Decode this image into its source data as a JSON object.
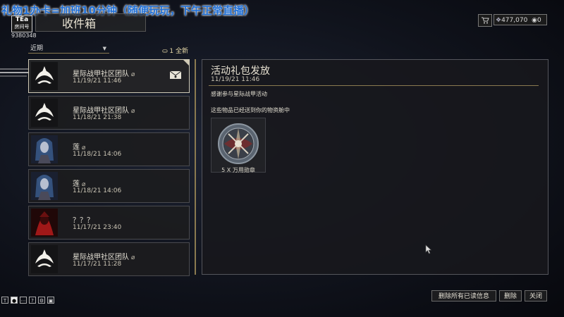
{
  "overlay": {
    "stream_title": "礼物1办卡=加班10分钟（随便玩玩，下午正常直播）",
    "room_badge_logo": "TEa",
    "room_badge_text": "房间号",
    "room_number": "9380348"
  },
  "header": {
    "title": "收件箱"
  },
  "currency": {
    "cart_icon": "cart-icon",
    "credits": "477,070",
    "platinum": "0"
  },
  "filter": {
    "selected": "近期",
    "new_count_label": "1 全新"
  },
  "messages": [
    {
      "sender": "星际战甲社区团队",
      "date": "11/19/21 11:46",
      "avatar": "lotus-logo",
      "attachment": true,
      "unread": true
    },
    {
      "sender": "星际战甲社区团队",
      "date": "11/18/21 21:38",
      "avatar": "lotus-logo",
      "attachment": true,
      "unread": false
    },
    {
      "sender": "莲",
      "date": "11/18/21 14:06",
      "avatar": "lotus-portrait",
      "attachment": true,
      "unread": false
    },
    {
      "sender": "莲",
      "date": "11/18/21 14:06",
      "avatar": "lotus-portrait",
      "attachment": true,
      "unread": false
    },
    {
      "sender": "？？？",
      "date": "11/17/21 23:40",
      "avatar": "red-figure-portrait",
      "attachment": false,
      "unread": false
    },
    {
      "sender": "星际战甲社区团队",
      "date": "11/17/21 11:28",
      "avatar": "lotus-logo",
      "attachment": true,
      "unread": false
    }
  ],
  "detail": {
    "title": "活动礼包发放",
    "date": "11/19/21 11:46",
    "line1": "感谢参与星际战甲活动",
    "line2": "这些物品已经送到你的物资舱中",
    "attachment_label": "5 X 万用勋章"
  },
  "buttons": {
    "delete_read": "删除所有已读信息",
    "delete": "删除",
    "close": "关闭"
  },
  "bottom_icons": [
    "T",
    "chat-icon",
    "dots-icon",
    "?",
    "gear-icon",
    "lock-icon"
  ],
  "colors": {
    "accent_gold": "#8a7a50",
    "stream_title_blue": "#1f6fd6",
    "panel_border": "#55565c"
  }
}
